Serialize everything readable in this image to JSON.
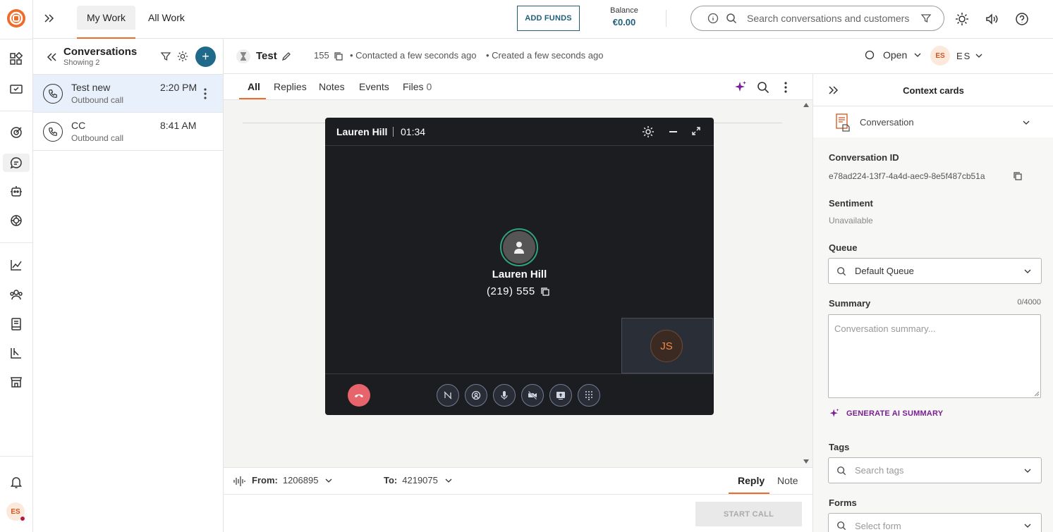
{
  "topbar": {
    "tab_my_work": "My Work",
    "tab_all_work": "All Work",
    "add_funds": "ADD FUNDS",
    "balance_label": "Balance",
    "balance_value": "€0.00",
    "search_placeholder": "Search conversations and customers"
  },
  "conversations": {
    "title": "Conversations",
    "subtitle": "Showing 2",
    "items": [
      {
        "name": "Test new",
        "sub": "Outbound call",
        "time": "2:20 PM"
      },
      {
        "name": "CC",
        "sub": "Outbound call",
        "time": "8:41 AM"
      }
    ]
  },
  "header": {
    "title": "Test",
    "count": "155",
    "contacted": "• Contacted a few seconds ago",
    "created": "• Created a few seconds ago",
    "status": "Open",
    "assignee_initials": "ES",
    "assignee_name": "ES"
  },
  "tabs": {
    "all": "All",
    "replies": "Replies",
    "notes": "Notes",
    "events": "Events",
    "files": "Files",
    "files_count": "0"
  },
  "call": {
    "caller": "Lauren Hill",
    "timer": "01:34",
    "contact_name": "Lauren Hill",
    "phone": "(219) 555",
    "self_initials": "JS"
  },
  "composer": {
    "from_label": "From:",
    "from_value": "1206895",
    "to_label": "To:",
    "to_value": "4219075",
    "reply_tab": "Reply",
    "note_tab": "Note",
    "start_call": "START CALL"
  },
  "context": {
    "title": "Context cards",
    "section": "Conversation",
    "conv_id_label": "Conversation ID",
    "conv_id_value": "e78ad224-13f7-4a4d-aec9-8e5f487cb51a",
    "sentiment_label": "Sentiment",
    "sentiment_value": "Unavailable",
    "queue_label": "Queue",
    "queue_value": "Default Queue",
    "summary_label": "Summary",
    "summary_count": "0/4000",
    "summary_placeholder": "Conversation summary...",
    "generate_ai": "GENERATE AI SUMMARY",
    "tags_label": "Tags",
    "tags_placeholder": "Search tags",
    "forms_label": "Forms",
    "forms_placeholder": "Select form"
  },
  "user": {
    "initials": "ES"
  },
  "colors": {
    "accent": "#f06a2a",
    "brand_teal": "#1f5f7a",
    "hangup": "#e8646c",
    "ai_purple": "#7a1f8f"
  }
}
